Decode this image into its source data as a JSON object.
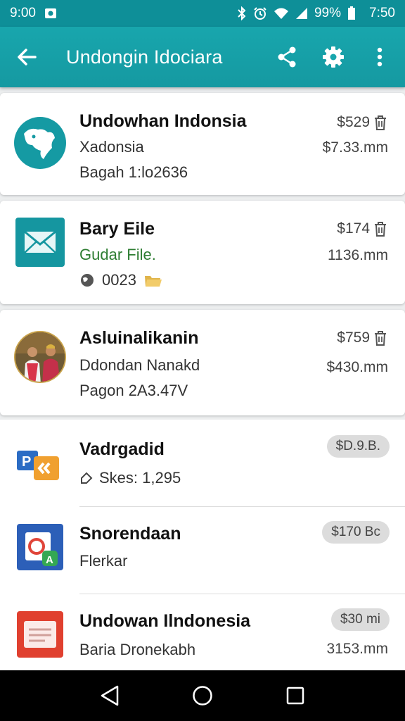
{
  "status_bar": {
    "time_left": "9:00",
    "battery_percent": "99%",
    "time_right": "7:50"
  },
  "app_bar": {
    "title": "Undongin Idociara"
  },
  "cards": [
    {
      "title": "Undowhan Indonsia",
      "subtitle": "Xadonsia",
      "meta": "Bagah 1:lo2636",
      "price": "$529",
      "secondary": "$7.33.mm",
      "avatar": "map-icon"
    },
    {
      "title": "Bary Eile",
      "subtitle": "Gudar File.",
      "meta": "0023",
      "price": "$174",
      "secondary": "1136.mm",
      "avatar": "mail-icon"
    },
    {
      "title": "Asluinalikanin",
      "subtitle": "Ddondan Nanakd",
      "meta": "Pagon 2A3.47V",
      "price": "$759",
      "secondary": "$430.mm",
      "avatar": "people-photo"
    }
  ],
  "list": [
    {
      "title": "Vadrgadid",
      "subtitle": "Skes: 1,295",
      "badge": "$D.9.B.",
      "secondary": ""
    },
    {
      "title": "Snorendaan",
      "subtitle": "Flerkar",
      "badge": "$170 Bc",
      "secondary": ""
    },
    {
      "title": "Undowan Ilndonesia",
      "subtitle": "Baria Dronekabh",
      "badge": "$30 mi",
      "secondary": "3153.mm"
    }
  ],
  "colors": {
    "app_bar": "#18a6ad",
    "status_bar": "#0e8f98",
    "subtitle_green": "#2e7d32"
  }
}
